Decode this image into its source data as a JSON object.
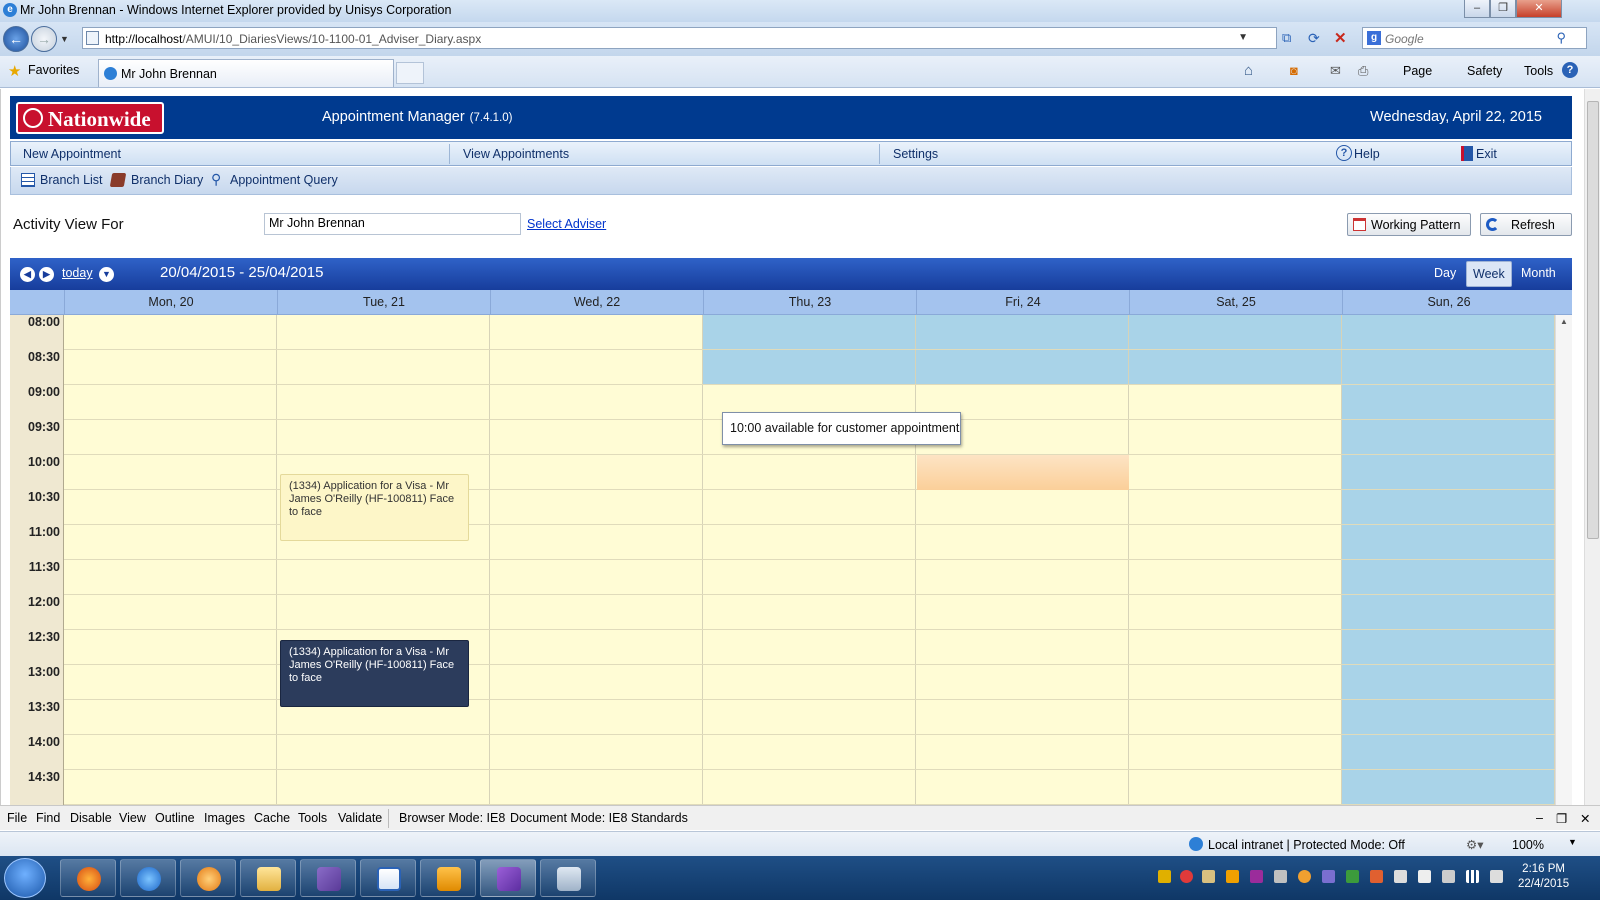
{
  "browser": {
    "window_title": "Mr John Brennan - Windows Internet Explorer provided by Unisys Corporation",
    "url_host": "http://localhost",
    "url_path": "/AMUI/10_DiariesViews/10-1100-01_Adviser_Diary.aspx",
    "search_placeholder": "Google",
    "favorites_label": "Favorites",
    "tab_title": "Mr John Brennan",
    "commands": {
      "page": "Page",
      "safety": "Safety",
      "tools": "Tools"
    }
  },
  "app": {
    "logo_text": "Nationwide",
    "title": "Appointment Manager",
    "version": "(7.4.1.0)",
    "date": "Wednesday, April 22, 2015",
    "menu": {
      "new_appointment": "New Appointment",
      "view_appointments": "View Appointments",
      "settings": "Settings",
      "help": "Help",
      "exit": "Exit"
    },
    "toolbar": {
      "branch_list": "Branch List",
      "branch_diary": "Branch Diary",
      "appointment_query": "Appointment Query"
    },
    "activity_label": "Activity View For",
    "adviser_value": "Mr John Brennan",
    "select_adviser": "Select Adviser",
    "working_pattern": "Working Pattern",
    "refresh": "Refresh"
  },
  "calendar": {
    "today_label": "today",
    "range": "20/04/2015 - 25/04/2015",
    "views": {
      "day": "Day",
      "week": "Week",
      "month": "Month"
    },
    "selected_view": "Week",
    "days": [
      "Mon, 20",
      "Tue, 21",
      "Wed, 22",
      "Thu, 23",
      "Fri, 24",
      "Sat, 25",
      "Sun, 26"
    ],
    "times": [
      "08:00",
      "08:30",
      "09:00",
      "09:30",
      "10:00",
      "10:30",
      "11:00",
      "11:30",
      "12:00",
      "12:30",
      "13:00",
      "13:30",
      "14:00",
      "14:30"
    ],
    "appointments": [
      {
        "text": "(1334) Application for a Visa - Mr James O'Reilly (HF-100811) Face to face"
      },
      {
        "text": "(1334) Application for a Visa - Mr James O'Reilly (HF-100811) Face to face"
      }
    ],
    "tooltip": "10:00 available for customer appointment",
    "colors": {
      "available": "#fffcd5",
      "unavailable": "#a9d3e8",
      "hover_slot": "#fbd7a8",
      "appt_light": "#fdf6c8",
      "appt_dark": "#2c3c5c",
      "header": "#1f4aa8"
    }
  },
  "devtools": {
    "items": [
      "File",
      "Find",
      "Disable",
      "View",
      "Outline",
      "Images",
      "Cache",
      "Tools",
      "Validate"
    ],
    "browser_mode": "Browser Mode: IE8",
    "document_mode": "Document Mode: IE8 Standards"
  },
  "status": {
    "zone": "Local intranet | Protected Mode: Off",
    "zoom": "100%"
  },
  "taskbar": {
    "time": "2:16 PM",
    "date": "22/4/2015"
  }
}
